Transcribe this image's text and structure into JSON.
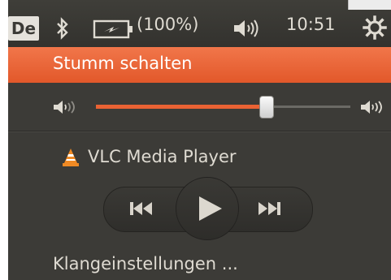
{
  "panel": {
    "keyboard_layout": "De",
    "battery_text": "(100%)",
    "clock": "10:51"
  },
  "menu": {
    "mute_label": "Stumm schalten",
    "volume_level": 0.67,
    "player_name": "VLC Media Player",
    "settings_label": "Klangeinstellungen ..."
  },
  "colors": {
    "accent": "#e95d2e",
    "panel_bg": "#3c3b37",
    "text": "#dfdbd2"
  },
  "icons": [
    "bluetooth-icon",
    "battery-icon",
    "volume-icon",
    "gear-icon",
    "vlc-icon",
    "previous-icon",
    "play-icon",
    "next-icon"
  ]
}
